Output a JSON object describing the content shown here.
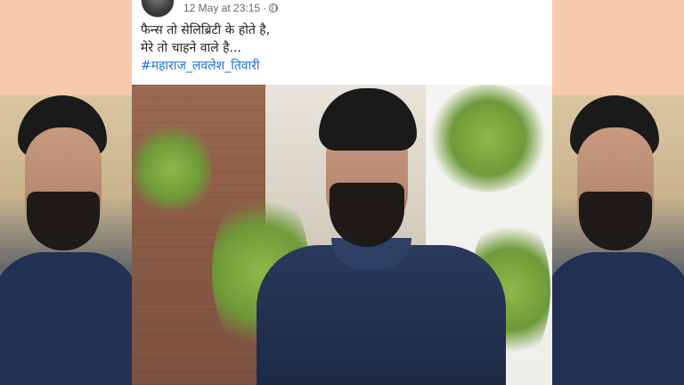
{
  "post": {
    "timestamp": "12 May at 23:15",
    "separator": "·",
    "privacy_icon": "globe-icon",
    "text_lines": [
      "फैन्स तो सेलिब्रिटी के होते है,",
      "मेरे तो चाहने वाले है..."
    ],
    "hashtag": "#महाराज_लवलेश_तिवारी",
    "photo_alt_icon": "photo"
  },
  "colors": {
    "background": "#f8c9ab",
    "hashtag": "#216fdb",
    "text": "#1c1e21",
    "meta": "#65676b"
  }
}
